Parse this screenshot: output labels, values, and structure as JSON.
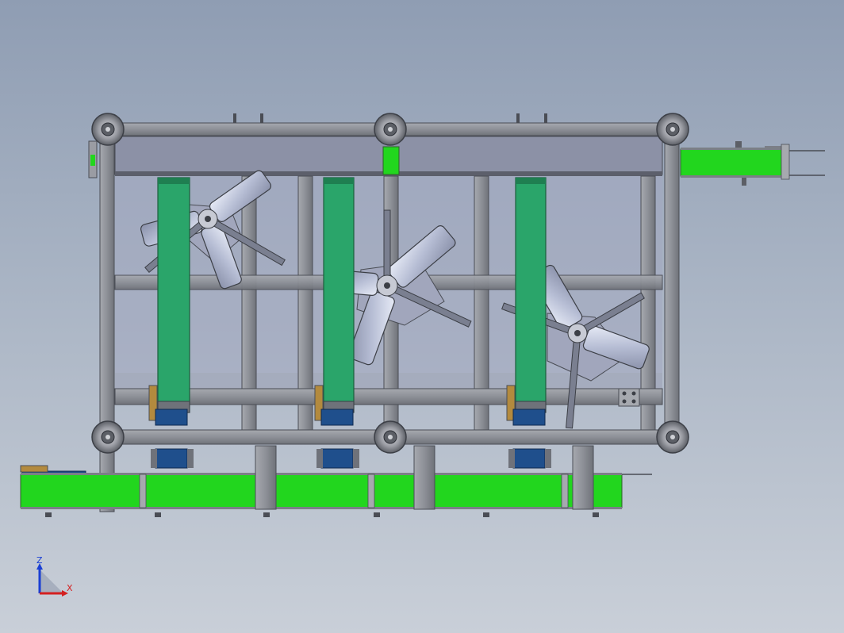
{
  "viewport": {
    "background_top": "#8f9db3",
    "background_bottom": "#c9cfd8"
  },
  "colors": {
    "frame": "#8c8f96",
    "frame_dark": "#4a4d55",
    "belt_green": "#22d61e",
    "belt_dark_green": "#1a9e4a",
    "vertical_belt": "#2aa56a",
    "paddle": "#bcc3da",
    "motor_blue": "#1f4f8c"
  },
  "triad": {
    "z_label": "Z",
    "x_label": "X",
    "z_color": "#1a3fd4",
    "x_color": "#d42020"
  },
  "model": {
    "components": [
      "frame",
      "top-conveyor",
      "bottom-conveyor",
      "vertical-belt-1",
      "vertical-belt-2",
      "vertical-belt-3",
      "paddle-wheel-1",
      "paddle-wheel-2",
      "paddle-wheel-3",
      "drive-motors"
    ]
  }
}
